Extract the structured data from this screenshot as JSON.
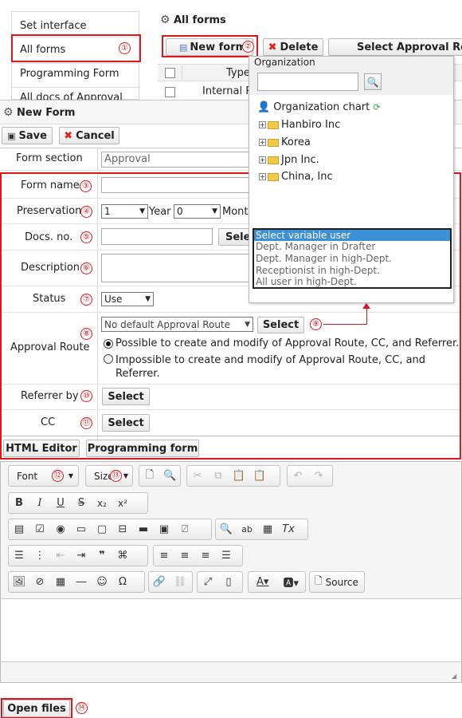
{
  "bg_page": {
    "sidebar_items": [
      "Set interface",
      "All forms",
      "Programming Form",
      "All docs of Approval"
    ],
    "title": "All forms",
    "toolbar": {
      "new_form": "New form",
      "delete": "Delete",
      "select_route": "Select Approval Route"
    },
    "table": {
      "header_type": "Type",
      "row1_type": "Internal R"
    }
  },
  "dialog": {
    "title": "New Form",
    "save": "Save",
    "cancel": "Cancel"
  },
  "form": {
    "form_section_label": "Form section",
    "form_section_value": "Approval",
    "form_name_label": "Form name",
    "preservation_label": "Preservation",
    "preservation_year_value": "1",
    "year_label": "Year",
    "preservation_month_value": "0",
    "month_label": "Month",
    "docs_no_label": "Docs. no.",
    "docs_select_partial": "Sele",
    "description_label": "Description",
    "status_label": "Status",
    "status_value": "Use",
    "approval_route_label": "Approval Route",
    "approval_route_value": "No default Approval Route",
    "approval_select": "Select",
    "radio_possible": "Possible to create and modify of Approval Route, CC, and Referrer.",
    "radio_impossible": "Impossible to create and modify of Approval Route, CC, and Referrer.",
    "referrer_label": "Referrer by",
    "referrer_select": "Select",
    "cc_label": "CC",
    "cc_select": "Select",
    "tab_html_editor": "HTML Editor",
    "tab_programming": "Programming form"
  },
  "editor": {
    "font_label": "Font",
    "size_label": "Size",
    "source_label": "Source"
  },
  "footer": {
    "open_files": "Open files"
  },
  "org_popup": {
    "title": "Organization",
    "chart_label": "Organization chart",
    "nodes": [
      "Hanbiro Inc",
      "Korea",
      "Jpn Inc.",
      "China, Inc"
    ],
    "variable_users": [
      "Select variable user",
      "Dept. Manager in Drafter",
      "Dept. Manager in high-Dept.",
      "Receptionist in high-Dept.",
      "All user in high-Dept."
    ]
  },
  "markers": [
    "①",
    "②",
    "③",
    "④",
    "⑤",
    "⑥",
    "⑦",
    "⑧",
    "⑨",
    "⑩",
    "⑪",
    "⑫",
    "⑬",
    "⑭"
  ],
  "colors": {
    "highlight_red": "#e0161c",
    "selected_blue": "#3d8fd6",
    "header_bg": "#f0f0f0"
  }
}
